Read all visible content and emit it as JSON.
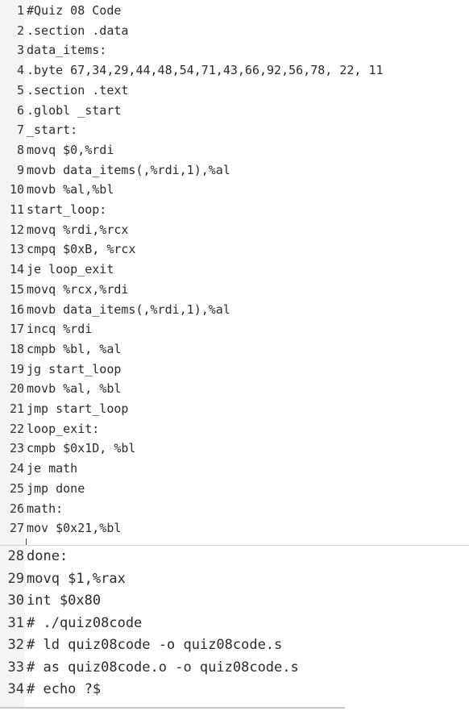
{
  "editor": {
    "top_pane": [
      {
        "n": "1",
        "text": "#Quiz 08 Code"
      },
      {
        "n": "2",
        "text": ".section .data"
      },
      {
        "n": "3",
        "text": "data_items:"
      },
      {
        "n": "4",
        "text": ".byte 67,34,29,44,48,54,71,43,66,92,56,78, 22, 11"
      },
      {
        "n": "5",
        "text": ".section .text"
      },
      {
        "n": "6",
        "text": ".globl _start"
      },
      {
        "n": "7",
        "text": "_start:"
      },
      {
        "n": "8",
        "text": "movq $0,%rdi"
      },
      {
        "n": "9",
        "text": "movb data_items(,%rdi,1),%al"
      },
      {
        "n": "10",
        "text": "movb %al,%bl"
      },
      {
        "n": "11",
        "text": "start_loop:"
      },
      {
        "n": "12",
        "text": "movq %rdi,%rcx"
      },
      {
        "n": "13",
        "text": "cmpq $0xB, %rcx"
      },
      {
        "n": "14",
        "text": "je loop_exit"
      },
      {
        "n": "15",
        "text": "movq %rcx,%rdi"
      },
      {
        "n": "16",
        "text": "movb data_items(,%rdi,1),%al"
      },
      {
        "n": "17",
        "text": "incq %rdi"
      },
      {
        "n": "18",
        "text": "cmpb %bl, %al"
      },
      {
        "n": "19",
        "text": "jg start_loop"
      },
      {
        "n": "20",
        "text": "movb %al, %bl"
      },
      {
        "n": "21",
        "text": "jmp start_loop"
      },
      {
        "n": "22",
        "text": "loop_exit:"
      },
      {
        "n": "23",
        "text": "cmpb $0x1D, %bl"
      },
      {
        "n": "24",
        "text": "je math"
      },
      {
        "n": "25",
        "text": "jmp done"
      },
      {
        "n": "26",
        "text": "math:"
      },
      {
        "n": "27",
        "text": "mov $0x21,%bl"
      }
    ],
    "bottom_pane": [
      {
        "n": "28",
        "text": "done:"
      },
      {
        "n": "29",
        "text": "movq $1,%rax"
      },
      {
        "n": "30",
        "text": "int $0x80"
      },
      {
        "n": "31",
        "text": "# ./quiz08code"
      },
      {
        "n": "32",
        "text": "# ld quiz08code -o quiz08code.s"
      },
      {
        "n": "33",
        "text": "# as quiz08code.o -o quiz08code.s"
      },
      {
        "n": "34",
        "text": "# echo ?$"
      }
    ]
  }
}
